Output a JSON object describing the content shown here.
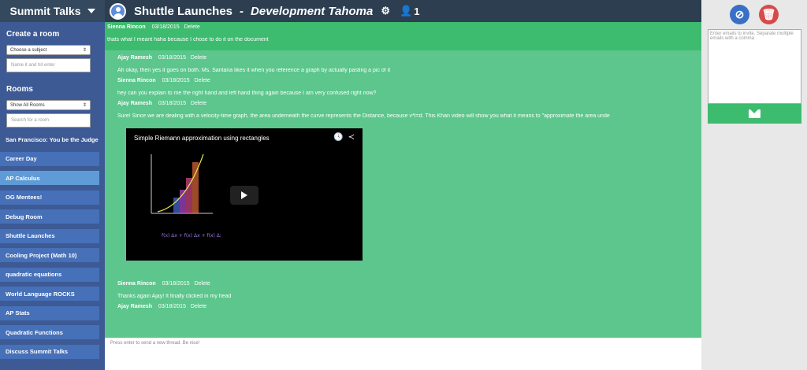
{
  "header": {
    "brand": "Summit Talks",
    "room_name": "Shuttle Launches",
    "separator": "-",
    "school": "Development Tahoma",
    "member_count": "1"
  },
  "sidebar": {
    "create_heading": "Create a room",
    "subject_select": "Choose a subject",
    "name_placeholder": "Name it and hit enter",
    "rooms_heading": "Rooms",
    "rooms_filter": "Show All Rooms",
    "search_placeholder": "Search for a room",
    "rooms": [
      "San Francisco: You be the Judge",
      "Career Day",
      "AP Calculus",
      "OG Mentees!",
      "Debug Room",
      "Shuttle Launches",
      "Cooling Project (Math 10)",
      "quadratic equations",
      "World Language ROCKS",
      "AP Stats",
      "Quadratic Functions",
      "Discuss Summit Talks"
    ]
  },
  "messages": [
    {
      "author": "Sienna Rincon",
      "date": "03/18/2015",
      "delete": "Delete",
      "text": "thats what I meant haha because I chose to do it on the document"
    },
    {
      "author": "Ajay Ramesh",
      "date": "03/18/2015",
      "delete": "Delete",
      "text": "Ah okay, then yes it goes on both. Ms. Santana likes it when you reference a graph by actually pasting a pic of it"
    },
    {
      "author": "Sienna Rincon",
      "date": "03/18/2015",
      "delete": "Delete",
      "text": "hey can you explain to me the right hand and left hand thing again because I am very confused right now?"
    },
    {
      "author": "Ajay Ramesh",
      "date": "03/18/2015",
      "delete": "Delete",
      "text": "Sure! Since we are dealing with a velocity-time graph, the area underneath the curve represents the Distance, because v*t=d. This Khan video will show you what it means to \"approximate the area unde"
    },
    {
      "author": "Sienna Rincon",
      "date": "03/18/2015",
      "delete": "Delete",
      "text": "Thanks again Ajay! It finally clicked in my head"
    },
    {
      "author": "Ajay Ramesh",
      "date": "03/18/2015",
      "delete": "Delete",
      "text": ""
    }
  ],
  "video": {
    "title": "Simple Riemann approximation using rectangles"
  },
  "composer": {
    "placeholder": "Press enter to send a new thread. Be nice!"
  },
  "invite": {
    "placeholder": "Enter emails to invite. Separate multiple emails with a comma"
  },
  "colors": {
    "header": "#2c3e50",
    "sidebar": "#3d5a95",
    "chat": "#5cc68c",
    "accent_green": "#3dbb6f",
    "ban": "#3a6fc7",
    "trash": "#d84a4a"
  }
}
